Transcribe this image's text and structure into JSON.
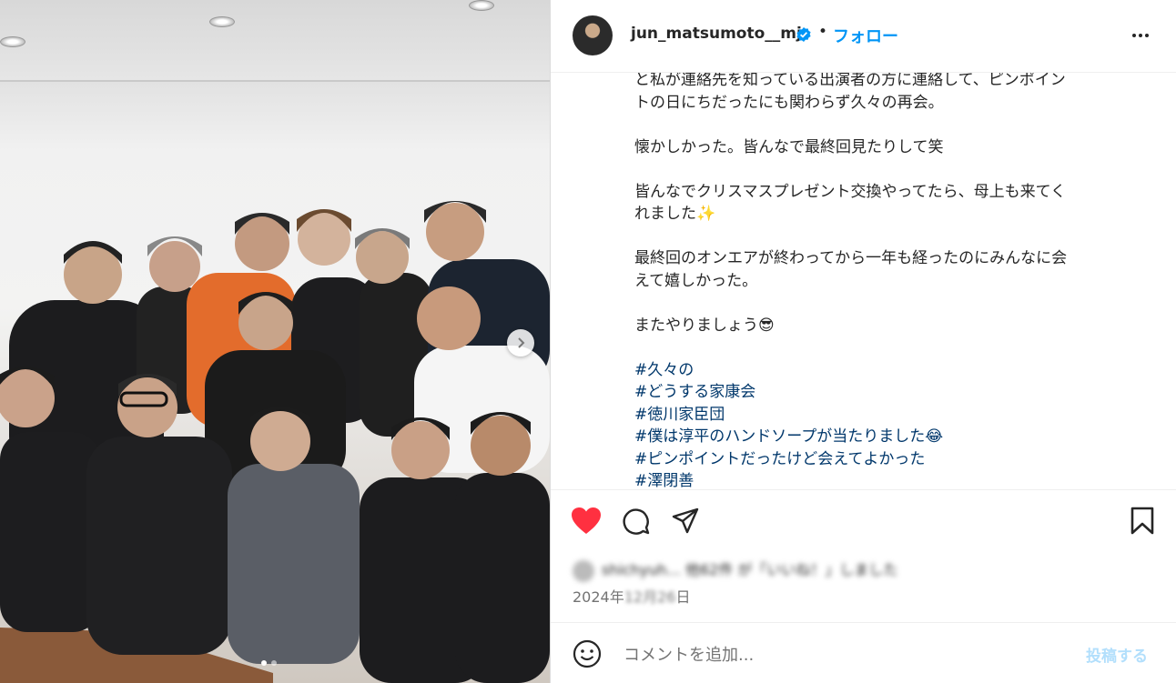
{
  "post": {
    "username": "jun_matsumoto__mj",
    "separator": "•",
    "follow_label": "フォロー",
    "caption_lines": [
      "と私が連絡先を知っている出演者の方に連絡して、ピンポイン",
      "トの日にちだったにも関わらず久々の再会。",
      "懐かしかった。皆んなで最終回見たりして笑",
      "皆んなでクリスマスプレゼント交換やってたら、母上も来てく",
      "れました✨",
      "最終回のオンエアが終わってから一年も経ったのにみんなに会",
      "えて嬉しかった。",
      "またやりましょう😎"
    ],
    "hashtags": [
      "#久々の",
      "#どうする家康会",
      "#徳川家臣団",
      "#僕は淳平のハンドソープが当たりました😂",
      "#ピンポイントだったけど会えてよかった",
      "#澤閉善"
    ],
    "likes_text": "shichyuh... 他62件 が「いいね！」しました",
    "date_prefix": "2024年",
    "date_blurred": "12月26",
    "date_suffix": "日"
  },
  "comment_box": {
    "placeholder": "コメントを追加...",
    "post_label": "投稿する"
  },
  "icons": {
    "verified": "verified-badge-icon",
    "more": "more-options-icon",
    "like": "heart-icon",
    "comment": "comment-icon",
    "share": "share-icon",
    "save": "bookmark-icon",
    "emoji": "emoji-icon",
    "next": "chevron-right-icon"
  },
  "colors": {
    "accent": "#0095f6",
    "like": "#ff3040",
    "hashtag": "#00376b",
    "post_disabled": "#b2dffc"
  },
  "carousel": {
    "slides": 2,
    "active": 0
  }
}
